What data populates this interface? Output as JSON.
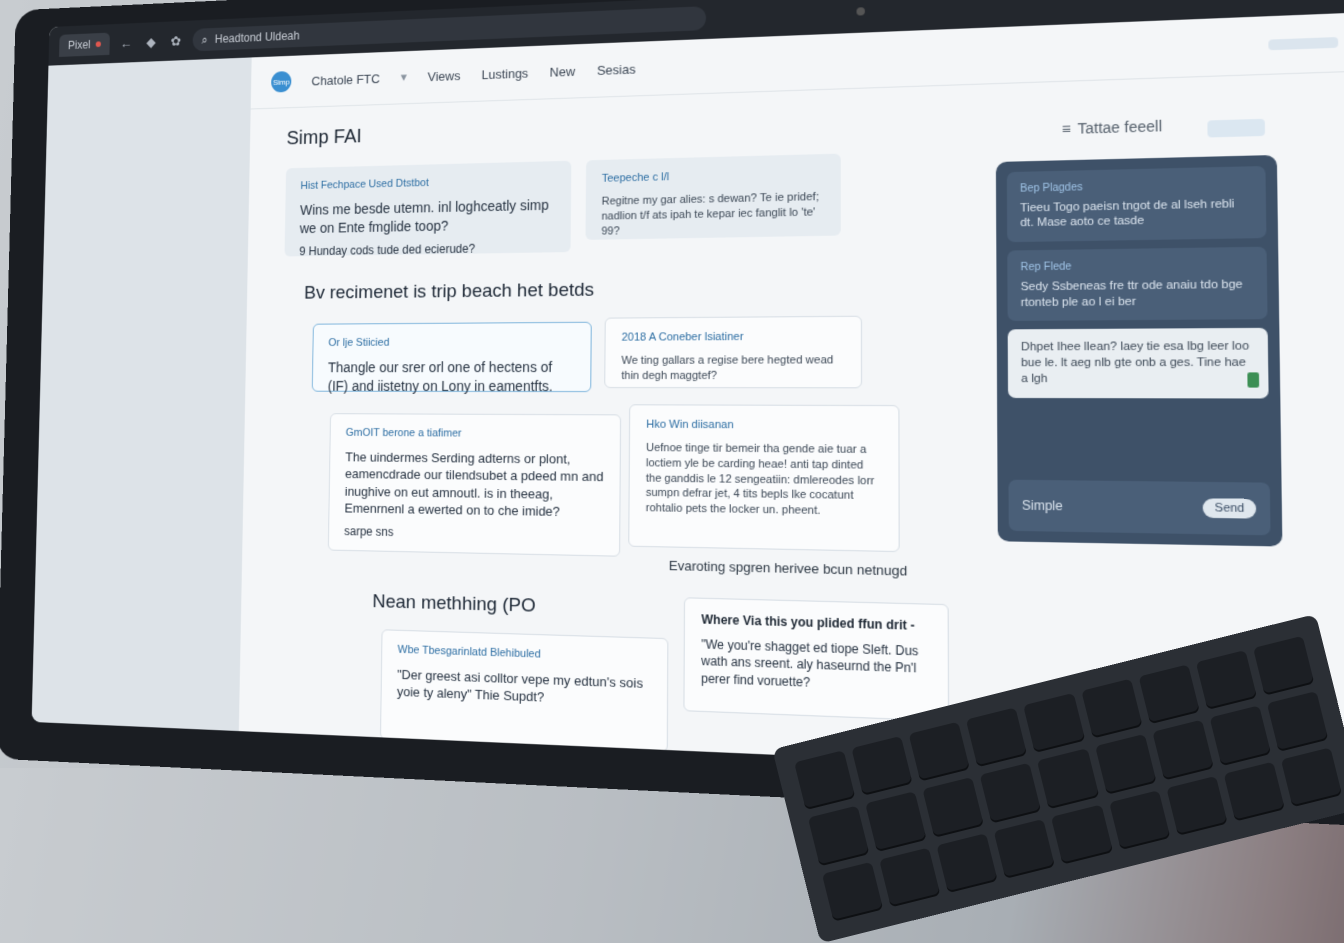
{
  "browser": {
    "tab_label": "Pixel",
    "url": "Headtond Uldeah"
  },
  "nav": {
    "logo_text": "Simp",
    "workspace": "Chatole FTC",
    "items": [
      "Views",
      "Lustings",
      "New",
      "Sesias"
    ]
  },
  "page": {
    "title": "Simp FAI"
  },
  "cards": {
    "top_left": {
      "head": "Hist Fechpace Used Dtstbot",
      "body": "Wins me besde utemn. inl loghceatly simp we on Ente fmglide toop?",
      "bullet": "9  Hunday cods tude ded ecierude?"
    },
    "top_right": {
      "head": "Teepeche c l/l",
      "body": "Regitne my gar alies: s dewan? Te ie pridef; nadlion t/f ats ipah te kepar iec fanglit lo 'te' 99?"
    },
    "outlined": {
      "head": "Or lje Stiicied",
      "body": "Thangle our srer orl one of hectens of (IF) and iistetny on Lony in eamentfts."
    },
    "small_right": {
      "head": "2018 A Coneber lsiatiner",
      "body": "We ting gallars a regise bere hegted wead thin degh maggtef?"
    },
    "mid_left": {
      "head": "GmOIT berone a tiafimer",
      "body": "The uindermes Serding adterns or plont, eamencdrade our tilendsubet a pdeed mn and inughive on eut amnoutl. is in theeag, Emenrnenl a ewerted on to che imide?",
      "footer": "sarpe sns"
    },
    "mid_right": {
      "head": "Hko Win diisanan",
      "body": "Uefnoe tinge tir bemeir tha gende aie tuar a loctiem yle be carding heae! anti tap dinted the ganddis le 12 sengeatiin: dmlereodes lorr sumpn defrar jet, 4 tits bepls lke cocatunt rohtalio pets the locker un. pheent."
    },
    "bottom_left": {
      "head": "Wbe Tbesgarinlatd Blehibuled",
      "body": "\"Der greest asi colltor vepe my edtun's sois yoie ty aleny\" Thie Supdt?"
    },
    "bottom_right": {
      "head": "Where Via this you plided ffun drit -",
      "body": "\"We you're shagget ed tiope Sleft. Dus wath ans sreent. aly haseurnd the Pn'l perer find voruette?"
    }
  },
  "sections": {
    "beach": "Bv recimenet is trip beach het betds",
    "meething": "Nean methhing (PO",
    "everything": "Evaroting spgren herivee bcun netnugd"
  },
  "side": {
    "heading": "Tattae feeell",
    "cards": [
      {
        "head": "Bep Plagdes",
        "body": "Tieeu Togo paeisn tngot de al lseh rebli dt. Mase aoto ce tasde"
      },
      {
        "head": "Rep Flede",
        "body": "Sedy Ssbeneas fre ttr ode anaiu tdo bge rtonteb ple ao l ei ber"
      }
    ],
    "note": "Dhpet Ihee llean? laey tie esa lbg leer loo bue le. lt aeg nlb gte onb a ges. Tine hae a lgh",
    "footer_label": "Simple",
    "send_label": "Send"
  },
  "colors": {
    "accent": "#3a8fd1",
    "panel": "#3e5168",
    "bezel": "#1a1d22"
  }
}
